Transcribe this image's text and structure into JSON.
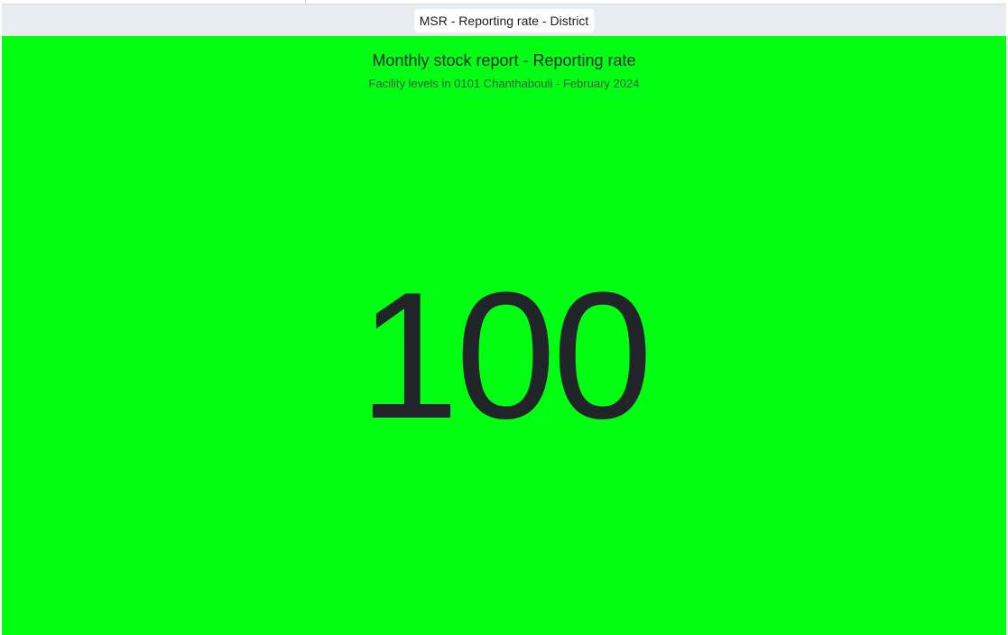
{
  "item": {
    "title": "MSR - Reporting rate - District"
  },
  "visualization": {
    "title": "Monthly stock report - Reporting rate",
    "subtitle": "Facility levels in 0101 Chanthabouli - February 2024",
    "value": "100",
    "background_color": "#00ff12",
    "text_color": "#212529"
  }
}
